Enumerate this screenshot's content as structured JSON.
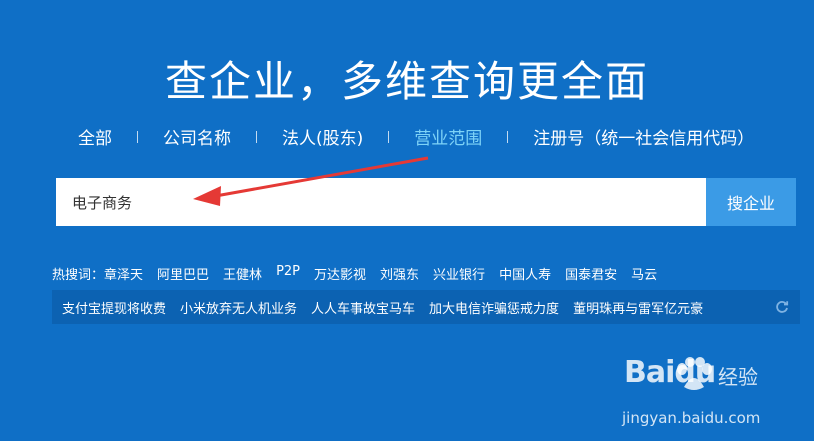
{
  "hero": {
    "title": "查企业，多维查询更全面"
  },
  "tabs": [
    {
      "label": "全部"
    },
    {
      "label": "公司名称"
    },
    {
      "label": "法人(股东)"
    },
    {
      "label": "营业范围",
      "active": true
    },
    {
      "label": "注册号（统一社会信用代码）"
    }
  ],
  "search": {
    "value": "电子商务",
    "button_label": "搜企业"
  },
  "hot_search": {
    "label": "热搜词：",
    "items": [
      "章泽天",
      "阿里巴巴",
      "王健林",
      "P2P",
      "万达影视",
      "刘强东",
      "兴业银行",
      "中国人寿",
      "国泰君安",
      "马云"
    ]
  },
  "news": {
    "items": [
      "支付宝提现将收费",
      "小米放弃无人机业务",
      "人人车事故宝马车",
      "加大电信诈骗惩戒力度",
      "董明珠再与雷军亿元豪"
    ]
  },
  "watermark": {
    "logo": "Baidu",
    "jingyan": "经验",
    "url": "jingyan.baidu.com"
  },
  "colors": {
    "background": "#0f6fc6",
    "active_tab": "#7ed3f7",
    "button": "#3b9be6",
    "arrow": "#e53935"
  }
}
